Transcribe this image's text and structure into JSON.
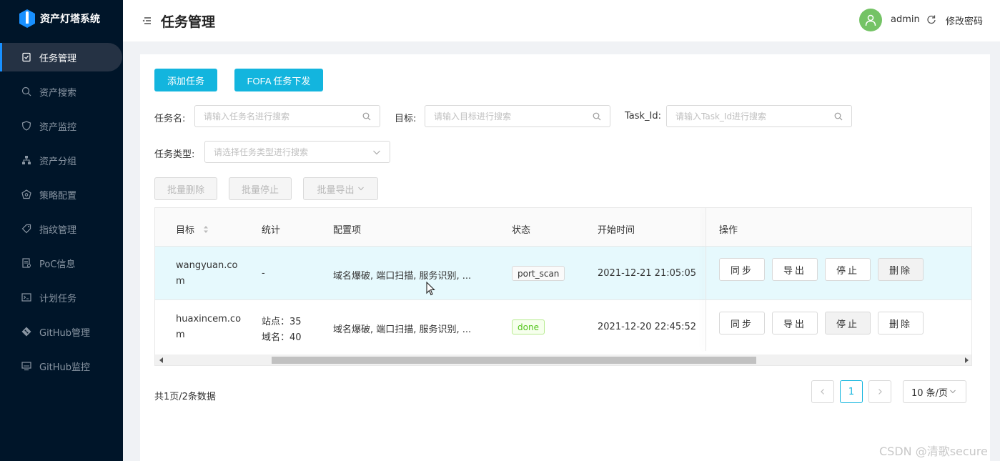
{
  "app": {
    "title": "资产灯塔系统"
  },
  "sidebar": {
    "items": [
      {
        "label": "任务管理",
        "icon": "task-icon",
        "active": true
      },
      {
        "label": "资产搜索",
        "icon": "search-icon"
      },
      {
        "label": "资产监控",
        "icon": "shield-icon"
      },
      {
        "label": "资产分组",
        "icon": "group-icon"
      },
      {
        "label": "策略配置",
        "icon": "policy-icon"
      },
      {
        "label": "指纹管理",
        "icon": "tag-icon"
      },
      {
        "label": "PoC信息",
        "icon": "doc-icon"
      },
      {
        "label": "计划任务",
        "icon": "terminal-icon"
      },
      {
        "label": "GitHub管理",
        "icon": "github-icon"
      },
      {
        "label": "GitHub监控",
        "icon": "monitor-icon"
      }
    ]
  },
  "header": {
    "title": "任务管理",
    "username": "admin",
    "change_password": "修改密码"
  },
  "toolbar": {
    "add_task": "添加任务",
    "fofa_task": "FOFA 任务下发"
  },
  "filters": {
    "task_name_label": "任务名:",
    "task_name_placeholder": "请输入任务名进行搜索",
    "target_label": "目标:",
    "target_placeholder": "请输入目标进行搜索",
    "task_id_label": "Task_Id:",
    "task_id_placeholder": "请输入Task_Id进行搜索",
    "task_type_label": "任务类型:",
    "task_type_placeholder": "请选择任务类型进行搜索"
  },
  "batch": {
    "delete": "批量删除",
    "stop": "批量停止",
    "export": "批量导出"
  },
  "table": {
    "headers": {
      "target": "目标",
      "stats": "统计",
      "config": "配置项",
      "status": "状态",
      "start_time": "开始时间",
      "actions": "操作"
    },
    "rows": [
      {
        "target_line1": "wangyuan.co",
        "target_line2": "m",
        "stats_line1": "-",
        "stats_line2": "",
        "config": "域名爆破, 端口扫描, 服务识别, ...",
        "status": "port_scan",
        "start_time": "2021-12-21 21:05:05",
        "actions": [
          "同步",
          "导出",
          "停止",
          "删除"
        ]
      },
      {
        "target_line1": "huaxincem.co",
        "target_line2": "m",
        "stats_line1": "站点：35",
        "stats_line2": "域名：40",
        "config": "域名爆破, 端口扫描, 服务识别, ...",
        "status": "done",
        "start_time": "2021-12-20 22:45:52",
        "actions": [
          "同步",
          "导出",
          "停止",
          "删除"
        ]
      }
    ]
  },
  "pagination": {
    "total_text": "共1页/2条数据",
    "current_page": "1",
    "page_size": "10 条/页"
  },
  "watermark": "CSDN @清歌secure",
  "colors": {
    "sidebar_bg": "#001529",
    "primary": "#13b5de",
    "done_tag": "#52c41a"
  }
}
